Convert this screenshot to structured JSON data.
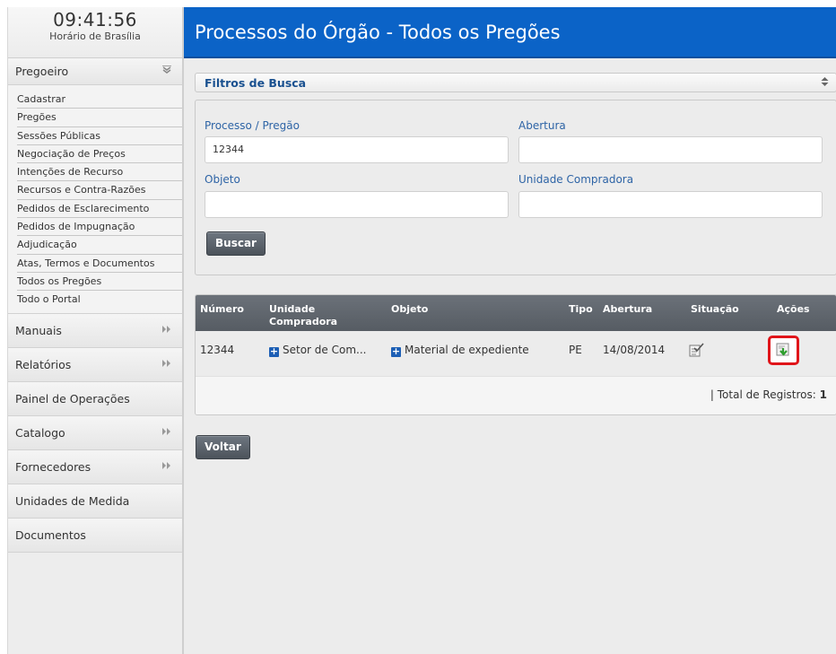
{
  "clock": {
    "time": "09:41:56",
    "timezone": "Horário de Brasília"
  },
  "sidebar": {
    "pregoeiro": {
      "label": "Pregoeiro",
      "items": [
        "Cadastrar",
        "Pregões",
        "Sessões Públicas",
        "Negociação de Preços",
        "Intenções de Recurso",
        "Recursos e Contra-Razões",
        "Pedidos de Esclarecimento",
        "Pedidos de Impugnação",
        "Adjudicação",
        "Atas, Termos e Documentos",
        "Todos os Pregões",
        "Todo o Portal"
      ]
    },
    "sections": [
      {
        "label": "Manuais",
        "expandable": true
      },
      {
        "label": "Relatórios",
        "expandable": true
      },
      {
        "label": "Painel de Operações",
        "expandable": false
      },
      {
        "label": "Catalogo",
        "expandable": true
      },
      {
        "label": "Fornecedores",
        "expandable": true
      },
      {
        "label": "Unidades de Medida",
        "expandable": false
      },
      {
        "label": "Documentos",
        "expandable": false
      }
    ]
  },
  "page": {
    "title": "Processos do Órgão - Todos os Pregões"
  },
  "filters": {
    "header": "Filtros de Busca",
    "processo_label": "Processo / Pregão",
    "processo_value": "12344",
    "abertura_label": "Abertura",
    "abertura_value": "",
    "objeto_label": "Objeto",
    "objeto_value": "",
    "unidade_label": "Unidade Compradora",
    "unidade_value": "",
    "search_button": "Buscar"
  },
  "results": {
    "headers": {
      "numero": "Número",
      "unidade": "Unidade Compradora",
      "objeto": "Objeto",
      "tipo": "Tipo",
      "abertura": "Abertura",
      "situacao": "Situação",
      "acoes": "Ações"
    },
    "rows": [
      {
        "numero": "12344",
        "unidade": "Setor de Com...",
        "objeto": "Material de expediente",
        "tipo": "PE",
        "abertura": "14/08/2014"
      }
    ],
    "total_label": "| Total de Registros:",
    "total_value": "1"
  },
  "back_button": "Voltar",
  "icons": {
    "situacao": "checklist-icon",
    "acoes": "download-document-icon",
    "expand": "plus-icon"
  },
  "colors": {
    "title_bar": "#0b63c7",
    "filter_label": "#2e64a6",
    "highlight": "#e0151a",
    "table_header": "#5f656c"
  }
}
